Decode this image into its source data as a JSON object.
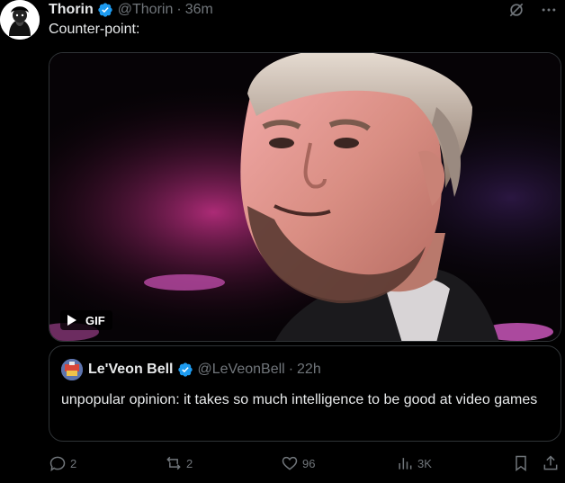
{
  "tweet": {
    "author_name": "Thorin",
    "handle": "@Thorin",
    "separator": "·",
    "time": "36m",
    "text": "Counter-point:",
    "media": {
      "badge": "GIF"
    }
  },
  "quote": {
    "author_name": "Le'Veon Bell",
    "handle": "@LeVeonBell",
    "separator": "·",
    "time": "22h",
    "text": "unpopular opinion: it takes so much intelligence to be good at video games"
  },
  "actions": {
    "replies": "2",
    "reposts": "2",
    "likes": "96",
    "views": "3K"
  },
  "colors": {
    "background": "#000000",
    "text": "#e7e9ea",
    "muted": "#71767b",
    "verified": "#1d9bf0",
    "border": "#2f3336"
  },
  "icons": [
    "verified-badge-icon",
    "grok-icon",
    "more-icon",
    "play-icon",
    "reply-icon",
    "repost-icon",
    "like-icon",
    "views-icon",
    "bookmark-icon",
    "share-icon"
  ]
}
